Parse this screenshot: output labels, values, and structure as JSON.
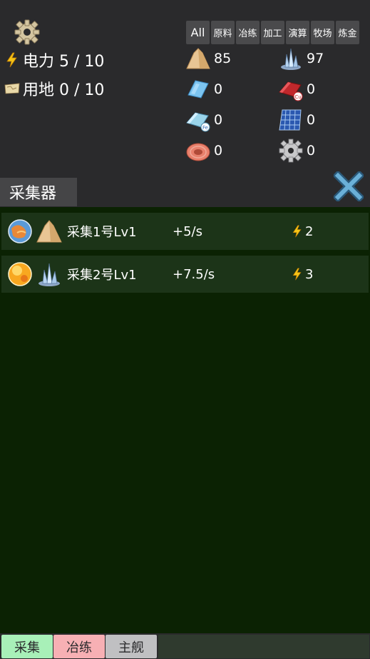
{
  "header": {
    "power_label": "电力 5 / 10",
    "land_label": "用地 0 / 10"
  },
  "filters": [
    "All",
    "原料",
    "冶练",
    "加工",
    "演算",
    "牧场",
    "炼金"
  ],
  "resources": [
    {
      "name": "sand-pile",
      "value": "85"
    },
    {
      "name": "crystal",
      "value": "97"
    },
    {
      "name": "glass-plate",
      "value": "0"
    },
    {
      "name": "copper-ingot",
      "value": "0"
    },
    {
      "name": "iron-ingot",
      "value": "0"
    },
    {
      "name": "solar-panel",
      "value": "0"
    },
    {
      "name": "copper-coil",
      "value": "0"
    },
    {
      "name": "gear",
      "value": "0"
    }
  ],
  "panel": {
    "title": "采集器",
    "rows": [
      {
        "name": "采集1号Lv1",
        "rate": "+5/s",
        "power": "2",
        "planet": "earth-planet",
        "material": "sand-pile"
      },
      {
        "name": "采集2号Lv1",
        "rate": "+7.5/s",
        "power": "3",
        "planet": "sun-planet",
        "material": "crystal"
      }
    ]
  },
  "tabs": [
    {
      "label": "采集",
      "color": "#a8f0b8"
    },
    {
      "label": "冶练",
      "color": "#f7b0b4"
    },
    {
      "label": "主舰",
      "color": "#c0c0c2"
    }
  ],
  "colors": {
    "background": "#2a2a2c",
    "panel": "#0b2203",
    "row": "#1c3418",
    "lightning": "#f5c518"
  }
}
